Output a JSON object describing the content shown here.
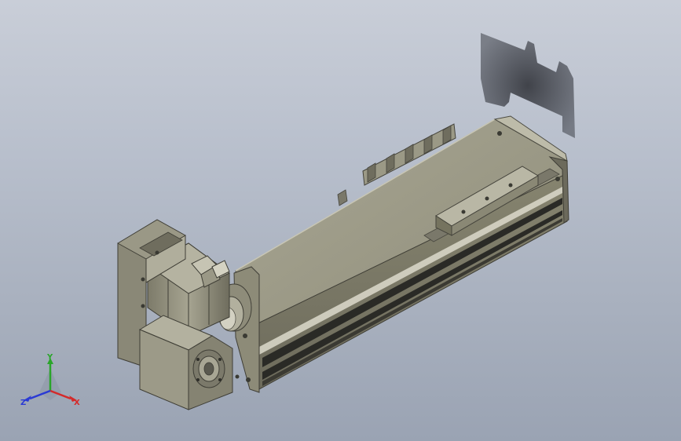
{
  "viewport": {
    "background_top": "#c9ced8",
    "background_bottom": "#9aa3b3"
  },
  "model": {
    "body_color": "#8f8d7a",
    "dark_color": "#5e5c4f",
    "light_color": "#b3b1a0",
    "slot_color": "#2a2a26"
  },
  "triad": {
    "x_label": "X",
    "y_label": "Y",
    "z_label": "Z",
    "x_color": "#d42a2a",
    "y_color": "#2aa52a",
    "z_color": "#2a3ad4"
  }
}
